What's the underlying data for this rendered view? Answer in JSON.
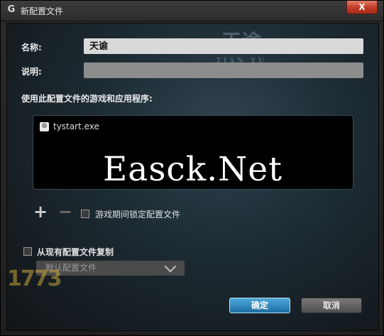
{
  "window": {
    "title": "新配置文件",
    "app_icon": "logitech-g-icon",
    "close_label": "X"
  },
  "form": {
    "name_label": "名称:",
    "name_value": "天谕",
    "desc_label": "说明:",
    "desc_value": "",
    "games_label": "使用此配置文件的游戏和应用程序:"
  },
  "games": [
    {
      "label": "tystart.exe",
      "icon": "exe-icon"
    }
  ],
  "watermarks": {
    "top_title": "天谕",
    "top_subtitle": "TIAN YU",
    "center": "Easck.Net",
    "corner": "1773"
  },
  "controls": {
    "add_label": "+",
    "remove_label": "−",
    "lock_label": "游戏期间锁定配置文件",
    "lock_checked": false,
    "copy_label": "从现有配置文件复制",
    "copy_checked": false,
    "copy_source": "默认配置文件"
  },
  "buttons": {
    "ok": "确定",
    "cancel": "取消"
  },
  "colors": {
    "accent": "#2a86c0",
    "close": "#c13a25"
  }
}
